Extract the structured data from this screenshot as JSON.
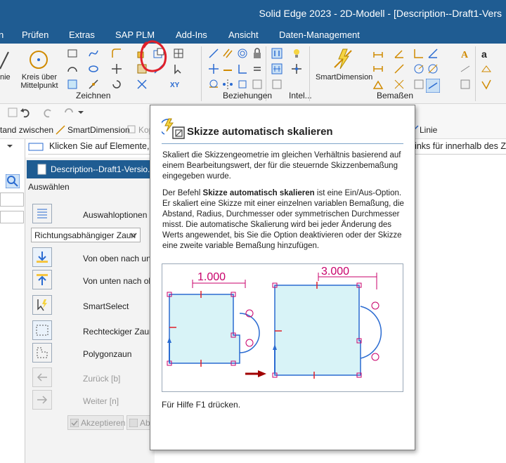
{
  "window": {
    "title": "Solid Edge 2023 - 2D-Modell - [Description--Draft1-Vers"
  },
  "menu": {
    "items": [
      "n",
      "Prüfen",
      "Extras",
      "SAP PLM",
      "Add-Ins",
      "Ansicht",
      "Daten-Management"
    ]
  },
  "ribbon": {
    "left_cmd_1": "nie",
    "circle_cmd": "Kreis über\nMittelpunkt",
    "smartdim_label": "SmartDimension",
    "groups": {
      "zeichnen": "Zeichnen",
      "beziehungen": "Beziehungen",
      "intel": "Intel...",
      "bemassen": "Bemaßen"
    }
  },
  "cmdbar": {
    "abstand": "tand zwischen",
    "smartdim": "SmartDimension",
    "kop": "Kop",
    "linie": "Linie"
  },
  "prompt": {
    "text": "Klicken Sie auf Elemente,",
    "right_text": "inks für innerhalb des Z"
  },
  "doc_tab": {
    "label": "Description--Draft1-Versio."
  },
  "selection": {
    "heading": "Auswählen",
    "auswahloptionen": "Auswahloptionen",
    "dropdown_value": "Richtungsabhängiger Zaun",
    "options": [
      "Von oben nach unte",
      "Von unten nach obe",
      "SmartSelect",
      "Rechteckiger Zaun",
      "Polygonzaun"
    ],
    "back": "Zurück [b]",
    "next": "Weiter [n]",
    "accept": "Akzeptieren",
    "abort": "Ab"
  },
  "tooltip": {
    "title": "Skizze automatisch skalieren",
    "para1": "Skaliert die Skizzengeometrie im gleichen Verhältnis basierend auf einem Bearbeitungswert, der für die steuernde Skizzenbemaßung eingegeben wurde.",
    "para2_prefix": "Der Befehl ",
    "para2_bold": "Skizze automatisch skalieren",
    "para2_suffix": " ist eine Ein/Aus-Option. Er skaliert eine Skizze mit einer einzelnen variablen Bemaßung, die Abstand, Radius, Durchmesser oder symmetrischen Durchmesser misst. Die automatische Skalierung wird bei jeder Änderung des Werts angewendet, bis Sie die Option deaktivieren oder der Skizze eine zweite variable Bemaßung hinzufügen.",
    "fig_dim_before": "1.000",
    "fig_dim_after": "3.000",
    "footer": "Für Hilfe F1 drücken."
  },
  "colors": {
    "titlebar": "#1f5c92",
    "dimension": "#c8006b",
    "sketch_fill": "#d8f3f7",
    "sketch_line": "#2a6bd1",
    "annotation": "#e0202a"
  }
}
